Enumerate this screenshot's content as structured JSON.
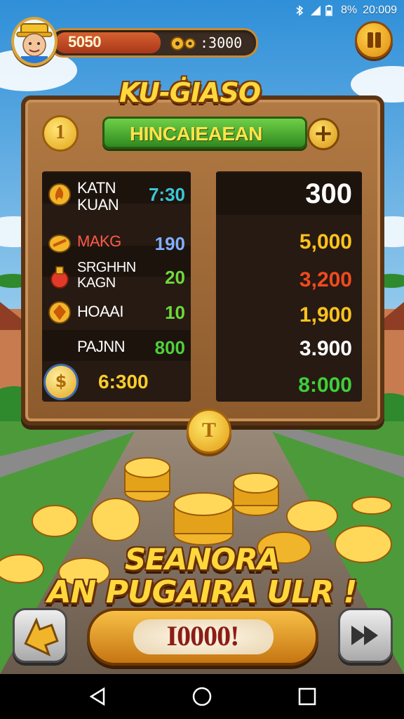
{
  "status_bar": {
    "battery": "8%",
    "time": "20:009"
  },
  "hud": {
    "score": "5050",
    "coins": ":3000"
  },
  "board": {
    "title": "KU-ĠIASO",
    "badge_label": "1",
    "banner": "HINCAIEAEAN",
    "plus_label": "+",
    "rows": [
      {
        "name": "KATN\nKUAN",
        "value": "7:30",
        "value_color": "#3ac7d6",
        "right_value": "300",
        "right_color": "#ffffff",
        "icon": "fire-icon"
      },
      {
        "name": "MAKG",
        "value": "190",
        "value_color": "#7fb0ff",
        "right_value": "5,000",
        "right_color": "#ffc21e",
        "icon": "shield-icon"
      },
      {
        "name": "SRGHHN\nKAGN",
        "value": "20",
        "value_color": "#6fd83c",
        "right_value": "3,200",
        "right_color": "#f04a1e",
        "icon": "potion-icon"
      },
      {
        "name": "HOAAI",
        "value": "10",
        "value_color": "#6fd83c",
        "right_value": "1,900",
        "right_color": "#ffc21e",
        "icon": "gem-icon"
      },
      {
        "name": "PAJNN",
        "value": "800",
        "value_color": "#4fcf3a",
        "right_value": "3.900",
        "right_color": "#ffffff",
        "icon": ""
      }
    ],
    "total_left": "6:300",
    "total_right": "8:000",
    "total_left_icon": "$",
    "mid_coin_label": "T"
  },
  "promo": {
    "line1": "SEANORA",
    "line2": "AN PUGAIRA ULR !"
  },
  "actions": {
    "big_button": "I0000!"
  },
  "colors": {
    "accent_gold": "#ffd83c",
    "board_wood": "#8c5a2c",
    "banner_green": "#2f8a20"
  }
}
